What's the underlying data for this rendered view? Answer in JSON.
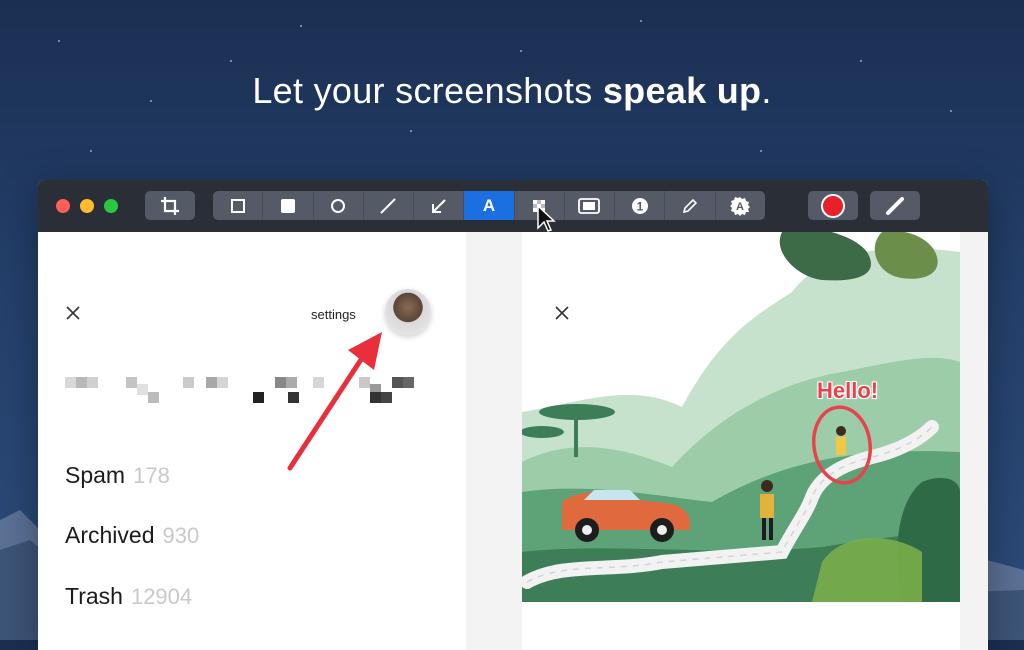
{
  "headline": {
    "prefix": "Let your screenshots ",
    "bold": "speak up",
    "suffix": "."
  },
  "toolbar": {
    "tools": [
      {
        "name": "rectangle-tool",
        "icon": "rect-outline-icon"
      },
      {
        "name": "filled-rectangle-tool",
        "icon": "rect-filled-icon"
      },
      {
        "name": "ellipse-tool",
        "icon": "circle-outline-icon"
      },
      {
        "name": "line-tool",
        "icon": "line-icon"
      },
      {
        "name": "arrow-tool",
        "icon": "arrow-icon"
      },
      {
        "name": "text-tool",
        "icon": "text-icon",
        "label": "A",
        "active": true
      },
      {
        "name": "pixelate-tool",
        "icon": "pixelate-icon"
      },
      {
        "name": "highlight-tool",
        "icon": "highlight-box-icon"
      },
      {
        "name": "counter-tool",
        "icon": "counter-icon",
        "label": "1"
      },
      {
        "name": "pencil-tool",
        "icon": "pencil-icon"
      },
      {
        "name": "auto-text-tool",
        "icon": "badge-text-icon",
        "label": "A"
      }
    ],
    "color": "#e8202a",
    "accent": "#1b6fe0"
  },
  "left_pane": {
    "settings_label": "settings",
    "items": [
      {
        "label": "Spam",
        "count": "178"
      },
      {
        "label": "Archived",
        "count": "930"
      },
      {
        "label": "Trash",
        "count": "12904"
      }
    ]
  },
  "right_pane": {
    "annotation_text": "Hello!"
  }
}
